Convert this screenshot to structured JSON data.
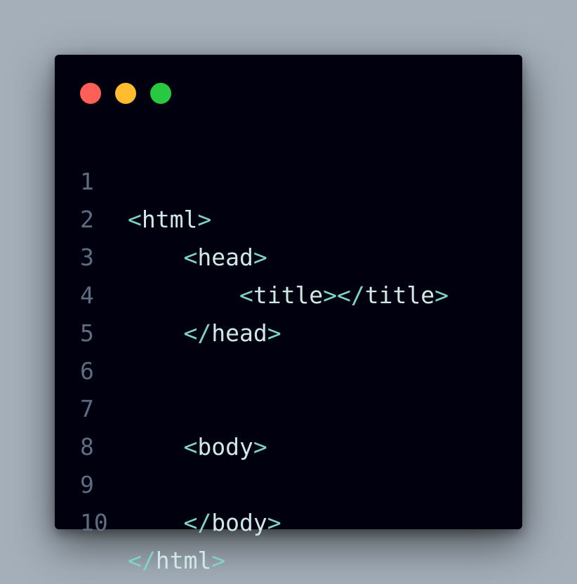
{
  "window": {
    "colors": {
      "background": "#00000f",
      "page_background": "#a4afba",
      "line_number": "#5d6e82",
      "code_text": "#cfe9e6",
      "punctuation": "#7fd4c6"
    },
    "controls": [
      {
        "name": "close",
        "color": "#ff5f57"
      },
      {
        "name": "minimize",
        "color": "#febc2e"
      },
      {
        "name": "maximize",
        "color": "#28c840"
      }
    ]
  },
  "code": {
    "lines": [
      {
        "number": "1",
        "indent": "",
        "open": "<",
        "tag": "html",
        "close": ">",
        "rest_open": "",
        "rest_tag": "",
        "rest_close": ""
      },
      {
        "number": "2",
        "indent": "    ",
        "open": "<",
        "tag": "head",
        "close": ">",
        "rest_open": "",
        "rest_tag": "",
        "rest_close": ""
      },
      {
        "number": "3",
        "indent": "        ",
        "open": "<",
        "tag": "title",
        "close": ">",
        "rest_open": "</",
        "rest_tag": "title",
        "rest_close": ">"
      },
      {
        "number": "4",
        "indent": "    ",
        "open": "</",
        "tag": "head",
        "close": ">",
        "rest_open": "",
        "rest_tag": "",
        "rest_close": ""
      },
      {
        "number": "5",
        "indent": "",
        "open": "",
        "tag": "",
        "close": "",
        "rest_open": "",
        "rest_tag": "",
        "rest_close": ""
      },
      {
        "number": "6",
        "indent": "",
        "open": "",
        "tag": "",
        "close": "",
        "rest_open": "",
        "rest_tag": "",
        "rest_close": ""
      },
      {
        "number": "7",
        "indent": "    ",
        "open": "<",
        "tag": "body",
        "close": ">",
        "rest_open": "",
        "rest_tag": "",
        "rest_close": ""
      },
      {
        "number": "8",
        "indent": "",
        "open": "",
        "tag": "",
        "close": "",
        "rest_open": "",
        "rest_tag": "",
        "rest_close": ""
      },
      {
        "number": "9",
        "indent": "    ",
        "open": "</",
        "tag": "body",
        "close": ">",
        "rest_open": "",
        "rest_tag": "",
        "rest_close": ""
      },
      {
        "number": "10",
        "indent": "",
        "open": "</",
        "tag": "html",
        "close": ">",
        "rest_open": "",
        "rest_tag": "",
        "rest_close": ""
      }
    ]
  }
}
